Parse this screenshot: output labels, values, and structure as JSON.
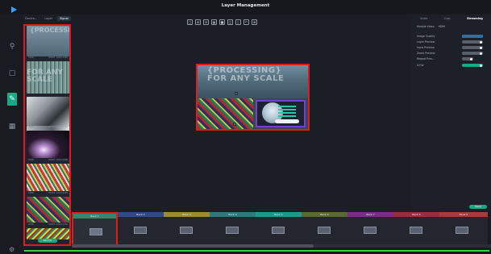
{
  "window": {
    "title": "Layer Management"
  },
  "topnav": {
    "items": [
      "Device...",
      "Layer",
      "Signal"
    ],
    "active_index": 2
  },
  "rail": {
    "icons": [
      "search-icon",
      "display-icon",
      "edit-icon",
      "grid-icon",
      "gear-icon"
    ],
    "active": "edit-icon"
  },
  "toolbar": {
    "glyphs": [
      "□",
      "⊞",
      "⊟",
      "▦",
      "■",
      "◫",
      "▯",
      "↶",
      "⊠"
    ]
  },
  "source_panel": {
    "add_label": "Add Src",
    "thumbs": [
      {
        "label_left": "HDMI",
        "label_right": "HDMI1 1920x1080"
      },
      {
        "label_left": "",
        "label_right": ""
      },
      {
        "label_left": "",
        "label_right": ""
      },
      {
        "label_left": "HDMI",
        "label_right": "HDMI2 1920x1080"
      },
      {
        "label_left": "HDMI",
        "label_right": "HDMI3 1920x1080"
      },
      {
        "label_left": "HDMI",
        "label_right": "HDMI4 1920x1080"
      },
      {
        "label_left": "HDMI",
        "label_right": "HDMI5 1920x1080"
      },
      {
        "label_left": "",
        "label_right": ""
      }
    ]
  },
  "canvas": {
    "watermark_line1": "{PROCESSING}",
    "watermark_line2": "FOR ANY SCALE"
  },
  "right_panel": {
    "tabs": [
      "Scale",
      "Crop",
      "Streaming"
    ],
    "active_tab": "Streaming",
    "module_label": "Module Video",
    "module_value": "HDMI",
    "rows": [
      {
        "label": "Image Quality",
        "control": "select"
      },
      {
        "label": "Layer Preview",
        "control": "toggle",
        "on": false
      },
      {
        "label": "Input Preview",
        "control": "toggle",
        "on": false
      },
      {
        "label": "Zoom Preview",
        "control": "toggle",
        "on": false
      },
      {
        "label": "Repeat Prev...",
        "control": "toggle",
        "on": false
      },
      {
        "label": "X-Y-W",
        "control": "toggle",
        "on": true
      }
    ],
    "action_label": "Save"
  },
  "banks": [
    {
      "label": "Bank 1",
      "color": "#2e8a6a"
    },
    {
      "label": "Bank 2",
      "color": "#2e4a8a"
    },
    {
      "label": "Bank 3",
      "color": "#a08a2e"
    },
    {
      "label": "Bank 4",
      "color": "#2e7a7a"
    },
    {
      "label": "Bank 5",
      "color": "#1a9a8a"
    },
    {
      "label": "Bank 6",
      "color": "#5a6a2e"
    },
    {
      "label": "Bank 7",
      "color": "#7a2e8a"
    },
    {
      "label": "Bank 8",
      "color": "#9a2e3a"
    },
    {
      "label": "Bank 9",
      "color": "#a83a3a"
    }
  ],
  "colors": {
    "accent": "#1aa886",
    "highlight": "#e01b1b",
    "status": "#38d04a"
  }
}
